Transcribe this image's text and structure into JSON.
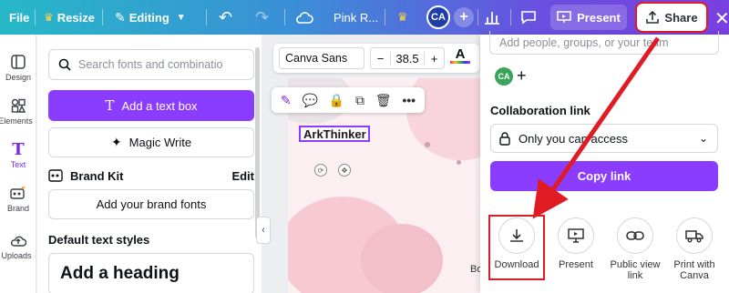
{
  "topbar": {
    "file": "File",
    "resize": "Resize",
    "editing": "Editing",
    "doc_title": "Pink R...",
    "avatar_initials": "CA",
    "present": "Present",
    "share": "Share"
  },
  "rail": {
    "items": [
      {
        "label": "Design",
        "icon": "design-icon"
      },
      {
        "label": "Elements",
        "icon": "elements-icon"
      },
      {
        "label": "Text",
        "icon": "text-icon"
      },
      {
        "label": "Brand",
        "icon": "brand-icon"
      },
      {
        "label": "Uploads",
        "icon": "uploads-icon"
      }
    ]
  },
  "panel": {
    "search_placeholder": "Search fonts and combinatio",
    "add_text_box": "Add a text box",
    "magic_write": "Magic Write",
    "brand_kit": "Brand Kit",
    "brand_edit": "Edit",
    "add_brand_fonts": "Add your brand fonts",
    "default_styles": "Default text styles",
    "add_heading": "Add a heading"
  },
  "editor": {
    "font_name": "Canva Sans",
    "font_size": "38.5",
    "selected_text": "ArkThinker",
    "partial_text": "Bo"
  },
  "share_panel": {
    "people_placeholder": "Add people, groups, or your team",
    "collab_avatar": "CA",
    "collab_label": "Collaboration link",
    "access_value": "Only you can access",
    "copy_link": "Copy link",
    "options": [
      {
        "label": "Download",
        "icon": "download-icon"
      },
      {
        "label": "Present",
        "icon": "present-screen-icon"
      },
      {
        "label": "Public view link",
        "icon": "link-icon"
      },
      {
        "label": "Print with Canva",
        "icon": "truck-icon"
      }
    ]
  },
  "colors": {
    "accent": "#8b3dff",
    "highlight": "#e01b24"
  }
}
